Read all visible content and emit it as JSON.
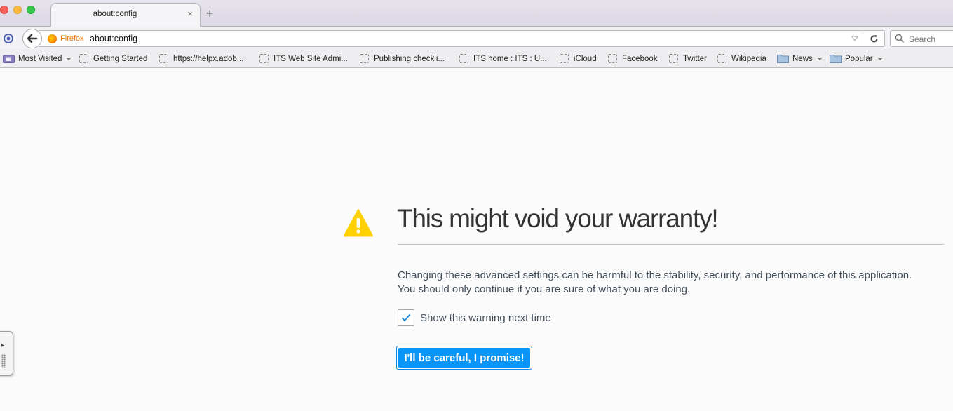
{
  "tab": {
    "title": "about:config",
    "close_glyph": "×",
    "new_tab_glyph": "+"
  },
  "navbar": {
    "identity_label": "Firefox",
    "url": "about:config",
    "search_placeholder": "Search"
  },
  "bookmarks": [
    {
      "label": "Most Visited",
      "icon": "most-visited-icon",
      "dropdown": true
    },
    {
      "label": "Getting Started",
      "icon": "bookmark-placeholder-icon"
    },
    {
      "label": "https://helpx.adob...",
      "icon": "bookmark-placeholder-icon"
    },
    {
      "label": "ITS Web Site Admi...",
      "icon": "bookmark-placeholder-icon"
    },
    {
      "label": "Publishing checkli...",
      "icon": "bookmark-placeholder-icon"
    },
    {
      "label": "ITS home : ITS : U...",
      "icon": "bookmark-placeholder-icon"
    },
    {
      "label": "iCloud",
      "icon": "bookmark-placeholder-icon"
    },
    {
      "label": "Facebook",
      "icon": "bookmark-placeholder-icon"
    },
    {
      "label": "Twitter",
      "icon": "bookmark-placeholder-icon"
    },
    {
      "label": "Wikipedia",
      "icon": "bookmark-placeholder-icon"
    },
    {
      "label": "News",
      "icon": "folder-icon",
      "dropdown": true
    },
    {
      "label": "Popular",
      "icon": "folder-icon",
      "dropdown": true
    }
  ],
  "warning": {
    "title": "This might void your warranty!",
    "message_line1": "Changing these advanced settings can be harmful to the stability, security, and performance of this application.",
    "message_line2": "You should only continue if you are sure of what you are doing.",
    "checkbox_label": "Show this warning next time",
    "checkbox_checked": true,
    "button_label": "I'll be careful, I promise!"
  },
  "colors": {
    "accent_button": "#0996f8",
    "warning_icon": "#ffd100",
    "firefox_orange": "#e8720c"
  }
}
